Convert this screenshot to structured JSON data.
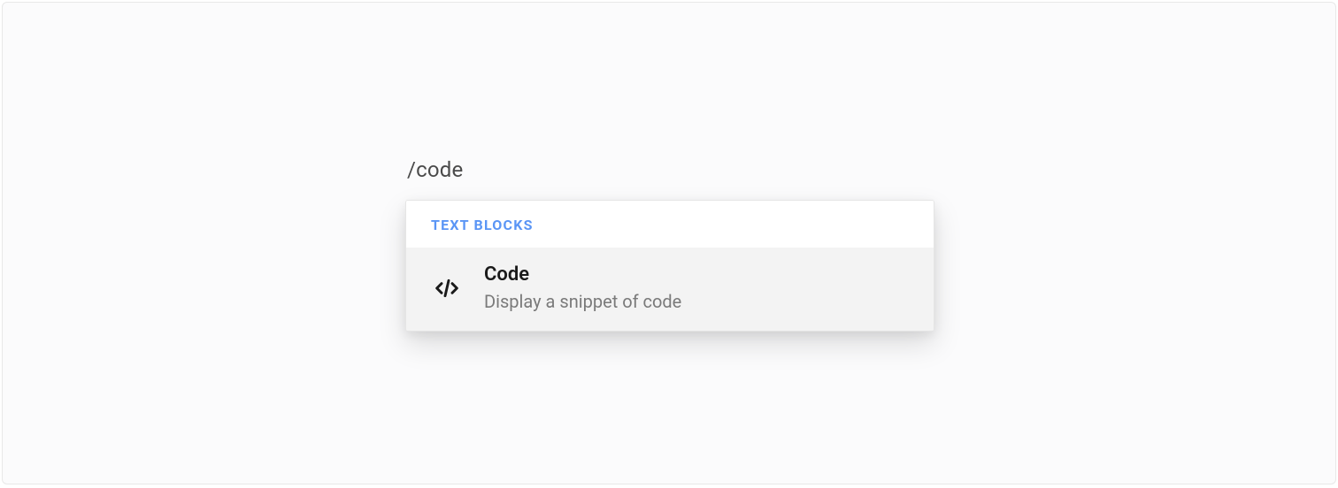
{
  "editor": {
    "command_input": "/code"
  },
  "dropdown": {
    "section_header": "TEXT BLOCKS",
    "items": [
      {
        "icon": "code-icon",
        "title": "Code",
        "description": "Display a snippet of code"
      }
    ]
  }
}
